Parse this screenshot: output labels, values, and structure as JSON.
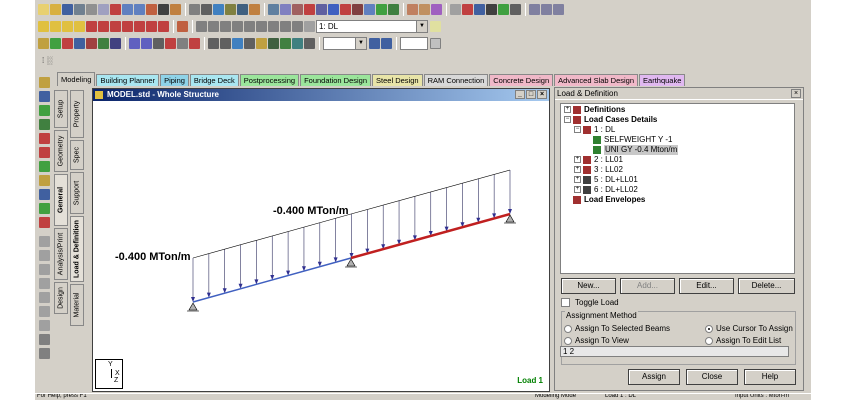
{
  "toolbar": {
    "load_case_select": "1: DL"
  },
  "mode_tabs": [
    {
      "label": "Modeling",
      "color": "#d4d0c8"
    },
    {
      "label": "Building Planner",
      "color": "#a9e6f0"
    },
    {
      "label": "Piping",
      "color": "#8fd3e8"
    },
    {
      "label": "Bridge Deck",
      "color": "#a9e6f0"
    },
    {
      "label": "Postprocessing",
      "color": "#9be59b"
    },
    {
      "label": "Foundation Design",
      "color": "#9be59b"
    },
    {
      "label": "Steel Design",
      "color": "#e8e4a8"
    },
    {
      "label": "RAM Connection",
      "color": "#d8d8d8"
    },
    {
      "label": "Concrete Design",
      "color": "#f0b8c8"
    },
    {
      "label": "Advanced Slab Design",
      "color": "#f0b8c8"
    },
    {
      "label": "Earthquake",
      "color": "#e0b8f0"
    }
  ],
  "vertical_tabs": {
    "setup": "Setup",
    "geometry": "Geometry",
    "general": "General",
    "analysis_print": "Analysis/Print",
    "design": "Design",
    "property": "Property",
    "spec": "Spec",
    "support": "Support",
    "load_definition": "Load & Definition",
    "material": "Material"
  },
  "view_window": {
    "title": "MODEL.std - Whole Structure",
    "load_label_left": "-0.400 MTon/m",
    "load_label_right": "-0.400 MTon/m",
    "active_load": "Load 1",
    "axis_y": "Y",
    "axis_x": "X",
    "axis_z": "Z"
  },
  "panel": {
    "title": "Load & Definition",
    "tree": {
      "definitions": "Definitions",
      "load_cases_details": "Load Cases Details",
      "case1": "1 : DL",
      "selfweight": "SELFWEIGHT Y -1",
      "uni_gy": "UNI GY -0.4 Mton/m",
      "case2": "2 : LL01",
      "case3": "3 : LL02",
      "case5": "5 : DL+LL01",
      "case6": "6 : DL+LL02",
      "load_envelopes": "Load Envelopes"
    },
    "buttons": {
      "new": "New...",
      "add": "Add...",
      "edit": "Edit...",
      "delete": "Delete..."
    },
    "toggle_load": "Toggle Load",
    "assignment_method": "Assignment Method",
    "radios": {
      "selected_beams": "Assign To Selected Beams",
      "use_cursor": "Use Cursor To Assign",
      "to_view": "Assign To View",
      "edit_list": "Assign To Edit List"
    },
    "edit_list_value": "1 2",
    "bottom_buttons": {
      "assign": "Assign",
      "close": "Close",
      "help": "Help"
    }
  },
  "statusbar": {
    "left": "For Help, press F1",
    "mode": "Modeling Mode",
    "load": "Load 1 : DL",
    "units": "Input Units : Mton-m"
  }
}
